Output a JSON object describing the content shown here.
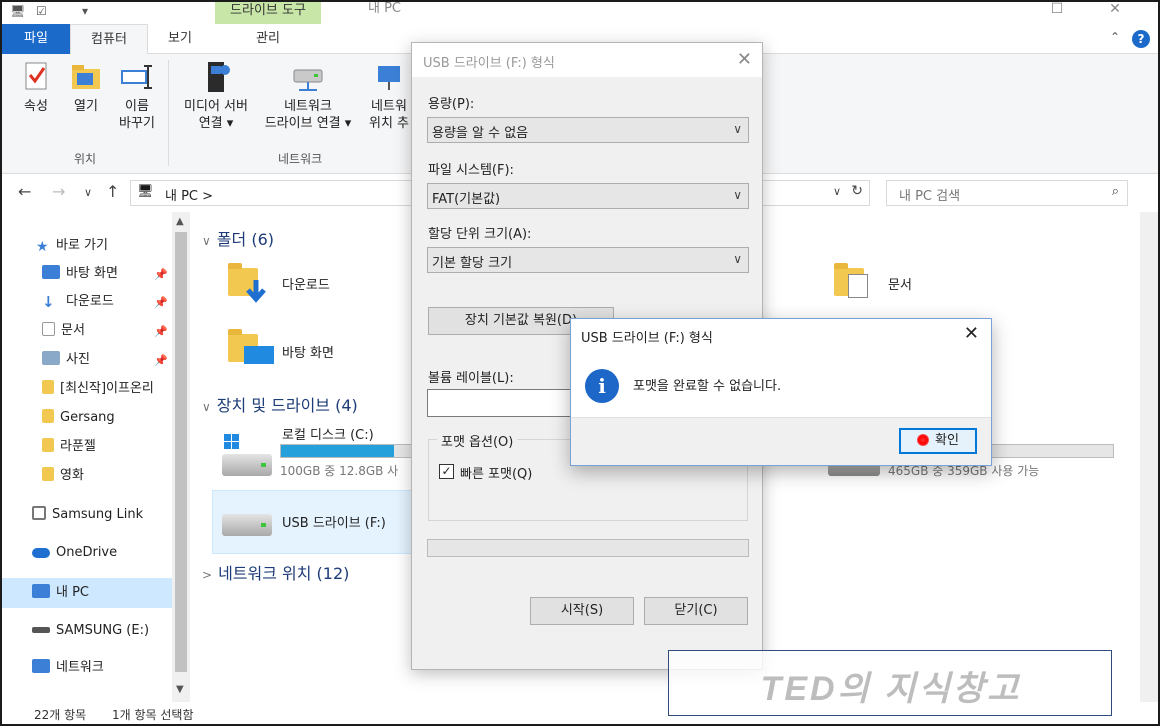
{
  "titlebar": {
    "tools_tab": "드라이브 도구",
    "window_title": "내 PC"
  },
  "ribbon_tabs": {
    "file": "파일",
    "computer": "컴퓨터",
    "view": "보기",
    "manage": "관리"
  },
  "ribbon": {
    "properties": "속성",
    "open": "열기",
    "rename_1": "이름",
    "rename_2": "바꾸기",
    "media_server_1": "미디어 서버",
    "media_server_2": "연결 ▾",
    "map_drive_1": "네트워크",
    "map_drive_2": "드라이브 연결 ▾",
    "net_location_1": "네트워",
    "net_location_2": "위치 추",
    "group_location": "위치",
    "group_network": "네트워크"
  },
  "address": {
    "path": "내 PC  >",
    "search_placeholder": "내 PC 검색"
  },
  "nav": {
    "quick_access": "바로 가기",
    "desktop": "바탕 화면",
    "downloads": "다운로드",
    "documents": "문서",
    "pictures": "사진",
    "folder_1": "[최신작]이프온리",
    "folder_2": "Gersang",
    "folder_3": "라푼젤",
    "folder_4": "영화",
    "samsung_link": "Samsung Link",
    "onedrive": "OneDrive",
    "this_pc": "내 PC",
    "samsung_e": "SAMSUNG (E:)",
    "network": "네트워크"
  },
  "content": {
    "folders_header": "폴더 (6)",
    "downloads": "다운로드",
    "desktop": "바탕 화면",
    "documents": "문서",
    "devices_header": "장치 및 드라이브 (4)",
    "local_disk": "로컬 디스크 (C:)",
    "local_disk_sub": "100GB 중 12.8GB 사",
    "local_disk_fill": 0.87,
    "usb_drive": "USB 드라이브 (F:)",
    "other_drive_sub": "465GB 중 359GB 사용 가능",
    "other_drive_fill": 0.23,
    "network_header": "네트워크 위치 (12)"
  },
  "status": {
    "items": "22개 항목",
    "selected": "1개 항목 선택함"
  },
  "format_dialog": {
    "title": "USB 드라이브 (F:) 형식",
    "capacity_label": "용량(P):",
    "capacity_value": "용량을 알 수 없음",
    "fs_label": "파일 시스템(F):",
    "fs_value": "FAT(기본값)",
    "alloc_label": "할당 단위 크기(A):",
    "alloc_value": "기본 할당 크기",
    "restore_btn": "장치 기본값 복원(D)",
    "volume_label": "볼륨 레이블(L):",
    "options_label": "포맷 옵션(O)",
    "quick_format": "빠른 포맷(Q)",
    "start_btn": "시작(S)",
    "close_btn": "닫기(C)"
  },
  "message_box": {
    "title": "USB 드라이브 (F:) 형식",
    "text": "포맷을 완료할 수 없습니다.",
    "ok": "확인"
  },
  "watermark": "TED의 지식창고"
}
